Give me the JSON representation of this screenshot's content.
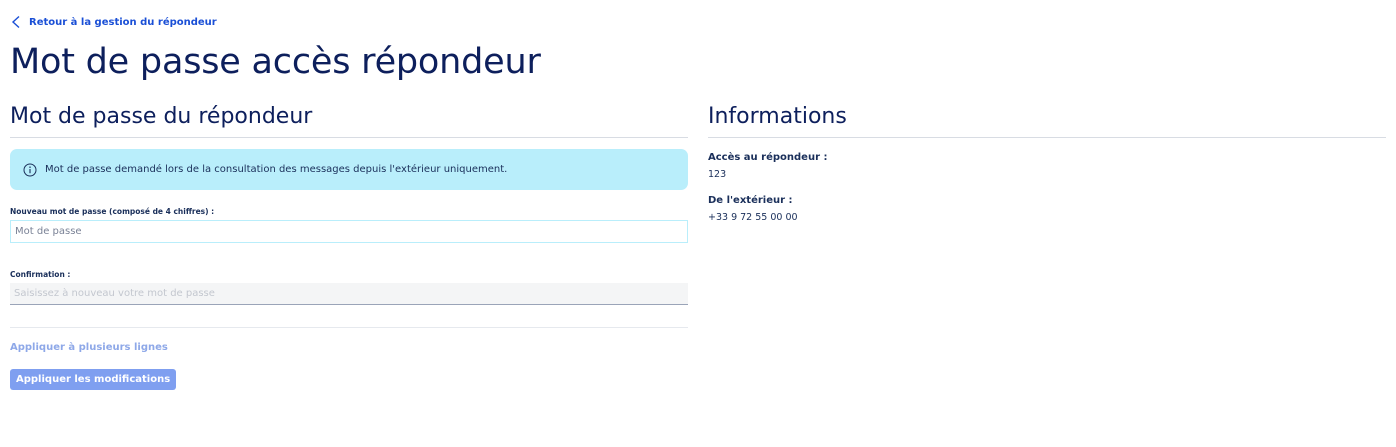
{
  "nav": {
    "back_label": "Retour à la gestion du répondeur",
    "back_icon": "chevron-left-icon"
  },
  "page": {
    "title": "Mot de passe accès répondeur"
  },
  "form": {
    "section_title": "Mot de passe du répondeur",
    "info_icon": "info-icon",
    "info_text": "Mot de passe demandé lors de la consultation des messages depuis l'extérieur uniquement.",
    "new_password": {
      "label": "Nouveau mot de passe (composé de 4 chiffres) :",
      "value": "",
      "placeholder": "Mot de passe"
    },
    "confirm_password": {
      "label": "Confirmation :",
      "value": "",
      "placeholder": "Saisissez à nouveau votre mot de passe"
    },
    "multi_lines_label": "Appliquer à plusieurs lignes",
    "apply_label": "Appliquer les modifications"
  },
  "informations": {
    "section_title": "Informations",
    "items": [
      {
        "label": "Accès au répondeur :",
        "value": "123"
      },
      {
        "label": "De l'extérieur :",
        "value": "+33 9 72 55 00 00"
      }
    ]
  },
  "colors": {
    "link": "#1a4fd6",
    "title": "#0d1f5c",
    "info_banner_bg": "#b9eefb",
    "button_disabled_bg": "#7f9ff0",
    "link_disabled": "#8ea8e8"
  }
}
